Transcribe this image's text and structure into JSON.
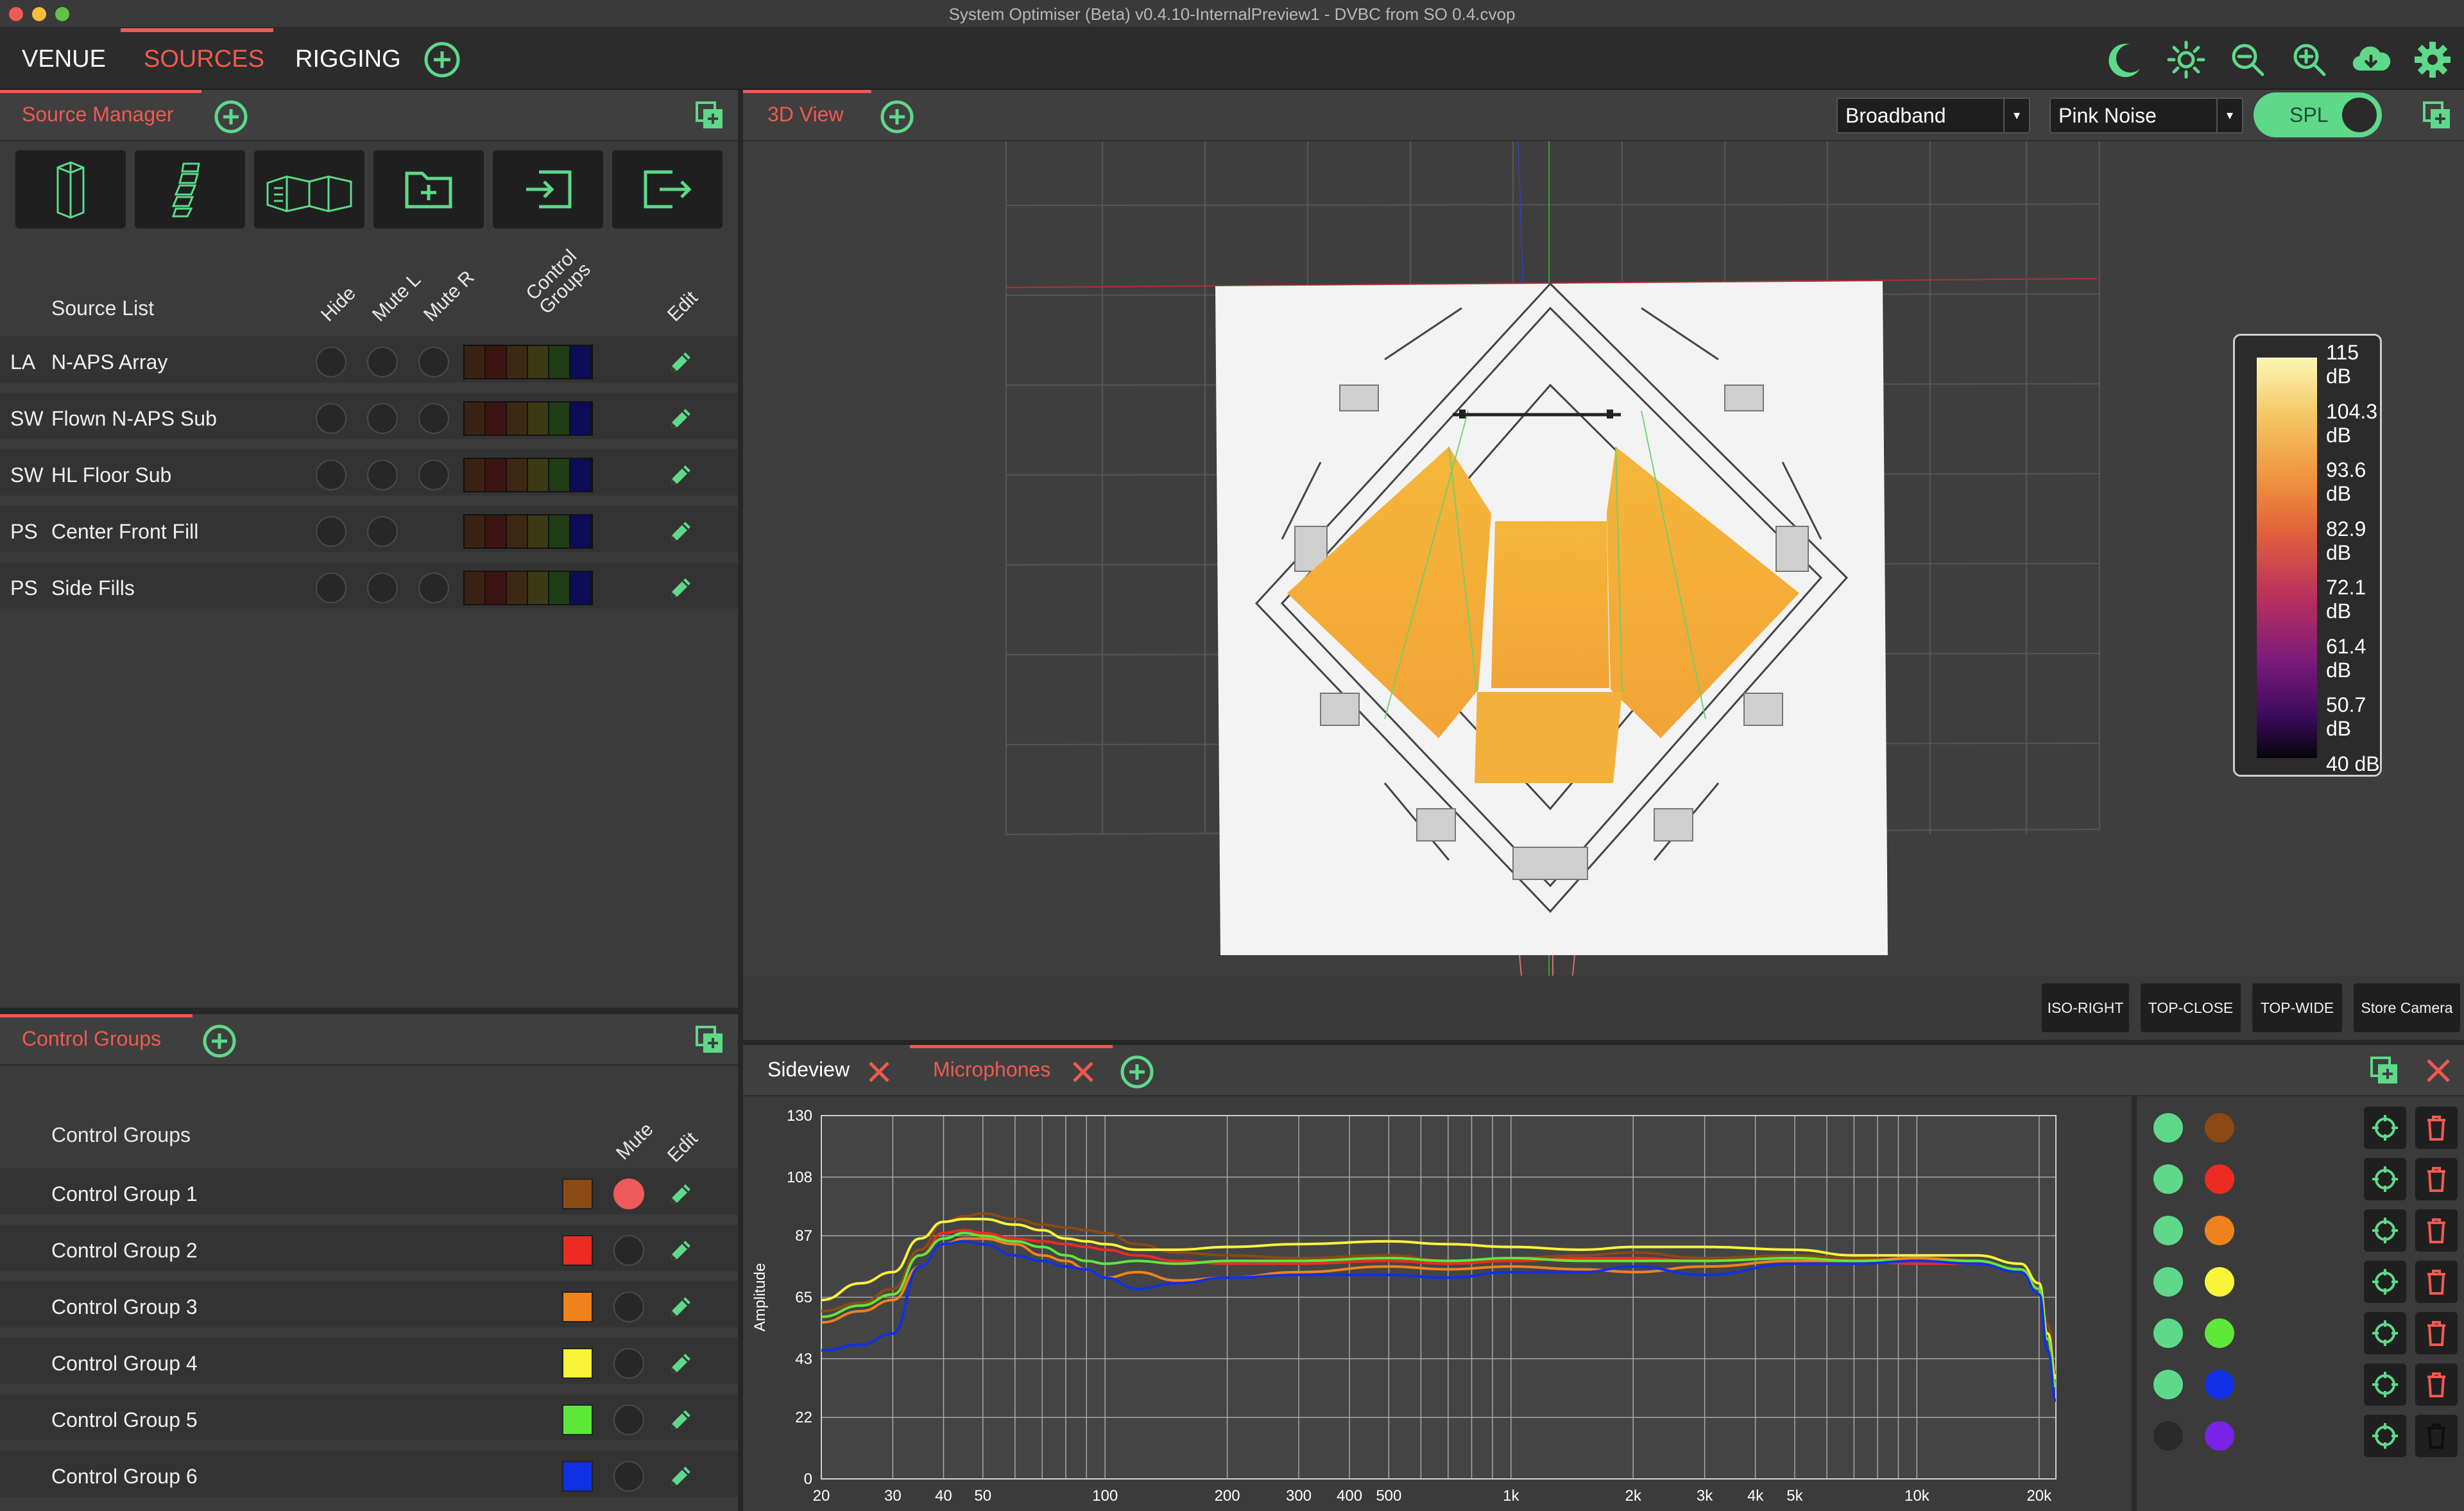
{
  "window": {
    "title": "System Optimiser (Beta) v0.4.10-InternalPreview1 - DVBC from SO 0.4.cvop"
  },
  "menu": {
    "items": [
      {
        "label": "VENUE",
        "active": false
      },
      {
        "label": "SOURCES",
        "active": true
      },
      {
        "label": "RIGGING",
        "active": false
      }
    ]
  },
  "source_manager": {
    "tab_label": "Source Manager",
    "list_header": "Source List",
    "col_headers": {
      "hide": "Hide",
      "mute_l": "Mute L",
      "mute_r": "Mute R",
      "control_groups": "Control Groups",
      "edit": "Edit"
    },
    "sources": [
      {
        "type": "LA",
        "name": "N-APS Array",
        "mute_r": true
      },
      {
        "type": "SW",
        "name": "Flown N-APS Sub",
        "mute_r": true
      },
      {
        "type": "SW",
        "name": "HL Floor Sub",
        "mute_r": true
      },
      {
        "type": "PS",
        "name": "Center Front Fill",
        "mute_r": false
      },
      {
        "type": "PS",
        "name": "Side Fills",
        "mute_r": true
      }
    ],
    "strip_colors": [
      "#3a2212",
      "#3d1414",
      "#3d2812",
      "#3b3a14",
      "#1e3d14",
      "#0c0c5a"
    ]
  },
  "control_groups": {
    "tab_label": "Control Groups",
    "list_header": "Control Groups",
    "col_headers": {
      "mute": "Mute",
      "edit": "Edit"
    },
    "groups": [
      {
        "name": "Control Group 1",
        "color": "#8b4a14",
        "muted": true
      },
      {
        "name": "Control Group 2",
        "color": "#ee2b22",
        "muted": false
      },
      {
        "name": "Control Group 3",
        "color": "#f0821e",
        "muted": false
      },
      {
        "name": "Control Group 4",
        "color": "#f8f43a",
        "muted": false
      },
      {
        "name": "Control Group 5",
        "color": "#5ee83a",
        "muted": false
      },
      {
        "name": "Control Group 6",
        "color": "#1030e6",
        "muted": false
      }
    ]
  },
  "view3d": {
    "tab_label": "3D View",
    "band_select": "Broadband",
    "signal_select": "Pink Noise",
    "spl_toggle_label": "SPL",
    "legend": [
      "115 dB",
      "104.3 dB",
      "93.6 dB",
      "82.9 dB",
      "72.1 dB",
      "61.4 dB",
      "50.7 dB",
      "40 dB"
    ],
    "camera_buttons": [
      "ISO-RIGHT",
      "TOP-CLOSE",
      "TOP-WIDE",
      "Store Camera"
    ]
  },
  "bottom_panel": {
    "tabs": [
      {
        "label": "Sideview",
        "active": false
      },
      {
        "label": "Microphones",
        "active": true
      }
    ]
  },
  "microphones": [
    {
      "enabled": true,
      "color": "#8b4a14"
    },
    {
      "enabled": true,
      "color": "#ee2b22"
    },
    {
      "enabled": true,
      "color": "#f0821e"
    },
    {
      "enabled": true,
      "color": "#f8f43a"
    },
    {
      "enabled": true,
      "color": "#5ee83a"
    },
    {
      "enabled": true,
      "color": "#1030e6"
    },
    {
      "enabled": false,
      "color": "#7a22e8"
    }
  ],
  "colors": {
    "accent": "#ef5a50",
    "green": "#5ed98a",
    "toggle_on": "#5ed98a"
  },
  "chart_data": {
    "type": "line",
    "title": "",
    "xlabel": "",
    "ylabel": "Amplitude",
    "x_scale": "log",
    "xlim": [
      20,
      22000
    ],
    "ylim": [
      0,
      130
    ],
    "y_ticks": [
      0,
      22,
      43,
      65,
      87,
      108,
      130
    ],
    "x_ticks": [
      {
        "v": 20,
        "label": "20"
      },
      {
        "v": 30,
        "label": "30"
      },
      {
        "v": 40,
        "label": "40"
      },
      {
        "v": 50,
        "label": "50"
      },
      {
        "v": 100,
        "label": "100"
      },
      {
        "v": 200,
        "label": "200"
      },
      {
        "v": 300,
        "label": "300"
      },
      {
        "v": 400,
        "label": "400"
      },
      {
        "v": 500,
        "label": "500"
      },
      {
        "v": 1000,
        "label": "1k"
      },
      {
        "v": 2000,
        "label": "2k"
      },
      {
        "v": 3000,
        "label": "3k"
      },
      {
        "v": 4000,
        "label": "4k"
      },
      {
        "v": 5000,
        "label": "5k"
      },
      {
        "v": 10000,
        "label": "10k"
      },
      {
        "v": 20000,
        "label": "20k"
      }
    ],
    "x": [
      20,
      25,
      30,
      35,
      40,
      45,
      50,
      60,
      70,
      80,
      90,
      100,
      120,
      150,
      200,
      300,
      500,
      700,
      1000,
      1500,
      2000,
      3000,
      5000,
      7000,
      10000,
      14000,
      18000,
      20000,
      21000,
      22000
    ],
    "series": [
      {
        "color": "#8b4a14",
        "values": [
          60,
          63,
          68,
          82,
          92,
          94,
          95,
          93,
          91,
          90,
          89,
          88,
          84,
          81,
          80,
          79,
          80,
          78,
          79,
          80,
          81,
          79,
          80,
          79,
          78,
          78,
          75,
          70,
          55,
          38
        ]
      },
      {
        "color": "#ee2b22",
        "values": [
          58,
          62,
          66,
          80,
          88,
          89,
          88,
          86,
          85,
          84,
          83,
          82,
          80,
          78,
          77,
          77,
          78,
          77,
          78,
          79,
          79,
          78,
          79,
          78,
          77,
          77,
          74,
          68,
          52,
          35
        ]
      },
      {
        "color": "#f0821e",
        "values": [
          56,
          60,
          64,
          76,
          84,
          86,
          86,
          84,
          80,
          78,
          75,
          72,
          74,
          71,
          72,
          74,
          76,
          75,
          76,
          75,
          74,
          76,
          78,
          78,
          79,
          78,
          74,
          66,
          50,
          34
        ]
      },
      {
        "color": "#f8f43a",
        "values": [
          64,
          70,
          74,
          86,
          92,
          93,
          93,
          91,
          89,
          86,
          85,
          84,
          82,
          82,
          83,
          84,
          85,
          84,
          83,
          82,
          83,
          83,
          82,
          80,
          80,
          80,
          77,
          70,
          52,
          36
        ]
      },
      {
        "color": "#5ee83a",
        "values": [
          58,
          62,
          66,
          80,
          86,
          88,
          87,
          85,
          83,
          80,
          78,
          77,
          78,
          77,
          78,
          78,
          79,
          78,
          79,
          78,
          78,
          78,
          79,
          78,
          78,
          78,
          75,
          68,
          50,
          33
        ]
      },
      {
        "color": "#1030e6",
        "values": [
          46,
          48,
          52,
          76,
          84,
          85,
          84,
          80,
          78,
          76,
          75,
          72,
          68,
          70,
          72,
          73,
          73,
          72,
          74,
          74,
          76,
          73,
          77,
          77,
          78,
          77,
          74,
          66,
          46,
          28
        ]
      }
    ]
  }
}
